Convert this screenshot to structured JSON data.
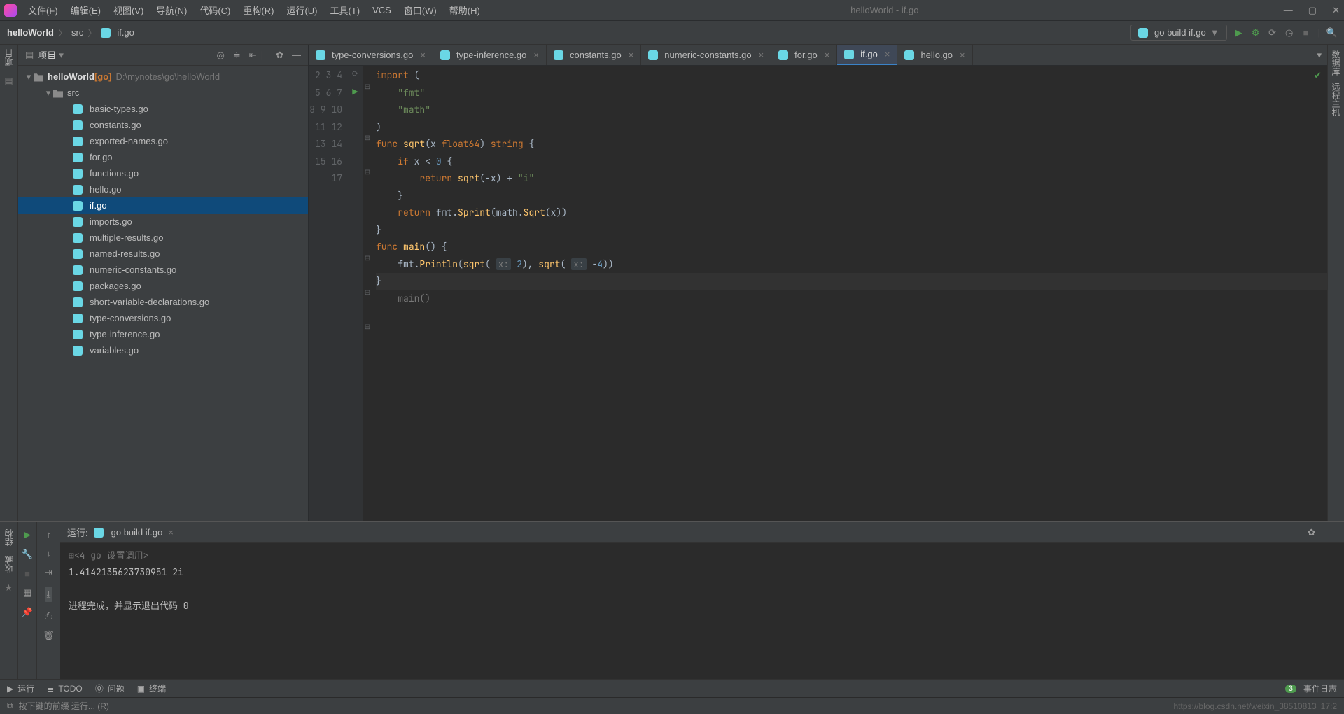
{
  "menubar": {
    "items": [
      "文件(F)",
      "编辑(E)",
      "视图(V)",
      "导航(N)",
      "代码(C)",
      "重构(R)",
      "运行(U)",
      "工具(T)",
      "VCS",
      "窗口(W)",
      "帮助(H)"
    ],
    "title": "helloWorld - if.go"
  },
  "breadcrumb": {
    "a": "helloWorld",
    "b": "src",
    "c": "if.go"
  },
  "runconfig": "go build if.go",
  "sidebar": {
    "title": "项目",
    "root": "helloWorld",
    "rootTag": "[go]",
    "rootPath": "D:\\mynotes\\go\\helloWorld",
    "srcDir": "src",
    "files": [
      "basic-types.go",
      "constants.go",
      "exported-names.go",
      "for.go",
      "functions.go",
      "hello.go",
      "if.go",
      "imports.go",
      "multiple-results.go",
      "named-results.go",
      "numeric-constants.go",
      "packages.go",
      "short-variable-declarations.go",
      "type-conversions.go",
      "type-inference.go",
      "variables.go"
    ],
    "selected": "if.go"
  },
  "tabs": [
    {
      "name": "type-conversions.go"
    },
    {
      "name": "type-inference.go"
    },
    {
      "name": "constants.go"
    },
    {
      "name": "numeric-constants.go"
    },
    {
      "name": "for.go"
    },
    {
      "name": "if.go",
      "active": true
    },
    {
      "name": "hello.go"
    }
  ],
  "code": {
    "start": 2,
    "lines": [
      "",
      "import (",
      "    \"fmt\"",
      "    \"math\"",
      ")",
      "",
      "func sqrt(x float64) string {",
      "    if x < 0 {",
      "        return sqrt(-x) + \"i\"",
      "    }",
      "    return fmt.Sprint(math.Sqrt(x))",
      "}",
      "",
      "func main() {",
      "    fmt.Println(sqrt( x: 2), sqrt( x: -4))",
      "}"
    ],
    "context": "main()"
  },
  "run": {
    "label": "运行:",
    "tab": "go build if.go",
    "prefix": "<4 go 设置调用>",
    "output": "1.4142135623730951 2i",
    "exit": "进程完成，并显示退出代码 0"
  },
  "bottombar": {
    "run": "运行",
    "todo": "TODO",
    "problems": "问题",
    "terminal": "终端",
    "events": "事件日志",
    "eventCount": "3"
  },
  "statusbar": {
    "hint": "按下键的前缀 运行... (R)",
    "url": "https://blog.csdn.net/weixin_38510813",
    "pos": "17:2"
  },
  "leftTabs": {
    "project": "项目",
    "structure": "结构",
    "favorites": "收藏"
  },
  "rightTabs": {
    "a": "数据库",
    "b": "远程主机"
  }
}
